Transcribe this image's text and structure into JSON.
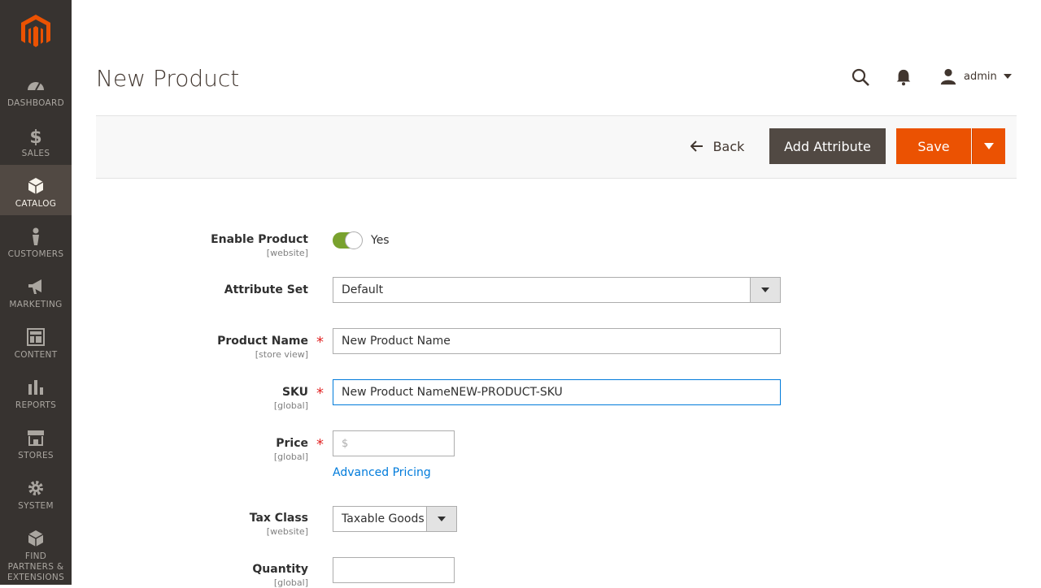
{
  "sidebar": {
    "items": [
      {
        "label": "DASHBOARD",
        "icon": "dashboard-icon"
      },
      {
        "label": "SALES",
        "icon": "dollar-icon"
      },
      {
        "label": "CATALOG",
        "icon": "catalog-box-icon"
      },
      {
        "label": "CUSTOMERS",
        "icon": "customer-person-icon"
      },
      {
        "label": "MARKETING",
        "icon": "megaphone-icon"
      },
      {
        "label": "CONTENT",
        "icon": "content-layout-icon"
      },
      {
        "label": "REPORTS",
        "icon": "bar-chart-icon"
      },
      {
        "label": "STORES",
        "icon": "store-icon"
      },
      {
        "label": "SYSTEM",
        "icon": "gear-icon"
      },
      {
        "label": "FIND PARTNERS & EXTENSIONS",
        "icon": "extensions-box-icon"
      }
    ]
  },
  "header": {
    "title": "New Product",
    "user": "admin"
  },
  "toolbar": {
    "back_label": "Back",
    "add_attribute_label": "Add Attribute",
    "save_label": "Save"
  },
  "form": {
    "enable_product": {
      "label": "Enable Product",
      "scope": "[website]",
      "value": "Yes"
    },
    "attribute_set": {
      "label": "Attribute Set",
      "value": "Default"
    },
    "product_name": {
      "label": "Product Name",
      "scope": "[store view]",
      "value": "New Product Name"
    },
    "sku": {
      "label": "SKU",
      "scope": "[global]",
      "value": "New Product NameNEW-PRODUCT-SKU"
    },
    "price": {
      "label": "Price",
      "scope": "[global]",
      "currency": "$",
      "value": "",
      "advanced_link": "Advanced Pricing"
    },
    "tax_class": {
      "label": "Tax Class",
      "scope": "[website]",
      "value": "Taxable Goods"
    },
    "quantity": {
      "label": "Quantity",
      "scope": "[global]",
      "value": ""
    }
  },
  "colors": {
    "sidebar_bg": "#373330",
    "accent_orange": "#eb5202",
    "button_dark": "#514943",
    "link_blue": "#007bdb",
    "toggle_green": "#79a22e",
    "required_red": "#e22626"
  }
}
